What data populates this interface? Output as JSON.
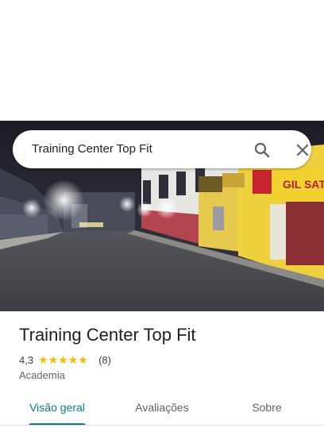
{
  "search": {
    "query": "Training Center Top Fit",
    "search_icon": "search-icon",
    "close_icon": "close-icon"
  },
  "hero": {
    "image_description": "street-view-photo",
    "signs": [
      "GIL SAT"
    ]
  },
  "place": {
    "title": "Training Center Top Fit",
    "rating": "4,3",
    "rating_value": 4.3,
    "rating_max": 5,
    "review_count": "(8)",
    "category": "Academia"
  },
  "tabs": [
    {
      "label": "Visão geral",
      "active": true
    },
    {
      "label": "Avaliações",
      "active": false
    },
    {
      "label": "Sobre",
      "active": false
    }
  ],
  "colors": {
    "accent": "#0b7a8f",
    "star": "#fbbc04",
    "text_primary": "#202124",
    "text_secondary": "#5f6368"
  }
}
